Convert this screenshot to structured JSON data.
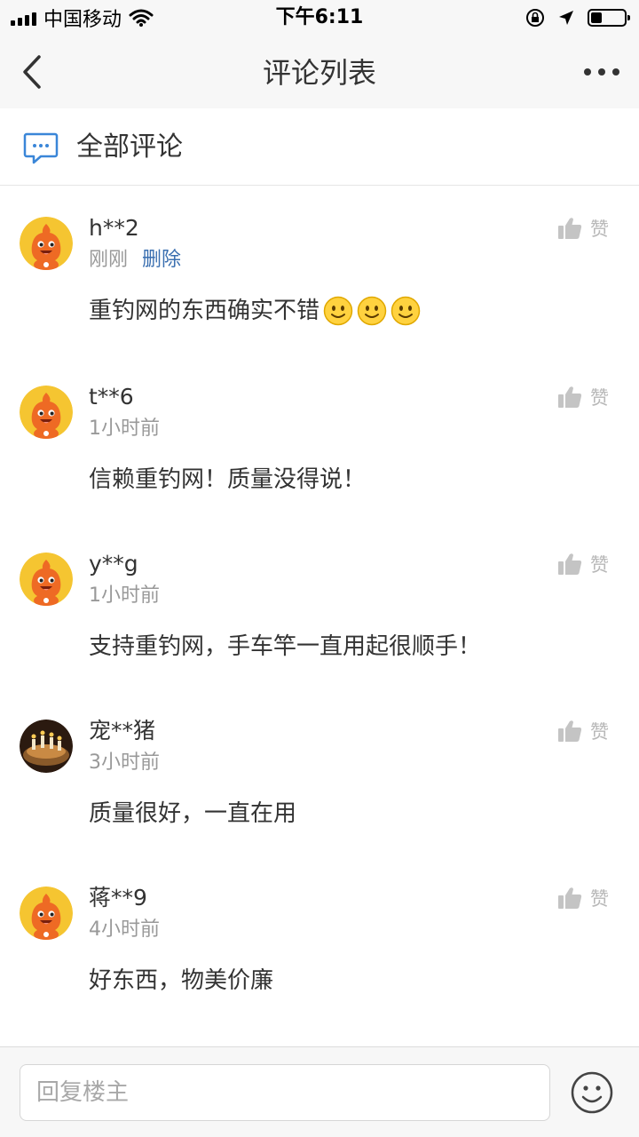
{
  "status_bar": {
    "carrier": "中国移动",
    "time": "下午6:11"
  },
  "nav": {
    "title": "评论列表"
  },
  "section": {
    "title": "全部评论"
  },
  "comments": [
    {
      "user": "h**2",
      "time": "刚刚",
      "delete_label": "删除",
      "text": "重钓网的东西确实不错",
      "like_label": "赞"
    },
    {
      "user": "t**6",
      "time": "1小时前",
      "text": "信赖重钓网！质量没得说！",
      "like_label": "赞"
    },
    {
      "user": "y**g",
      "time": "1小时前",
      "text": "支持重钓网，手车竿一直用起很顺手！",
      "like_label": "赞"
    },
    {
      "user": "宠**猪",
      "time": "3小时前",
      "text": "质量很好，一直在用",
      "like_label": "赞"
    },
    {
      "user": "蒋**9",
      "time": "4小时前",
      "text": "好东西，物美价廉",
      "like_label": "赞"
    }
  ],
  "reply": {
    "placeholder": "回复楼主"
  },
  "colors": {
    "link": "#3a6fb0",
    "accent_icon": "#3a86d8",
    "muted": "#999999"
  }
}
